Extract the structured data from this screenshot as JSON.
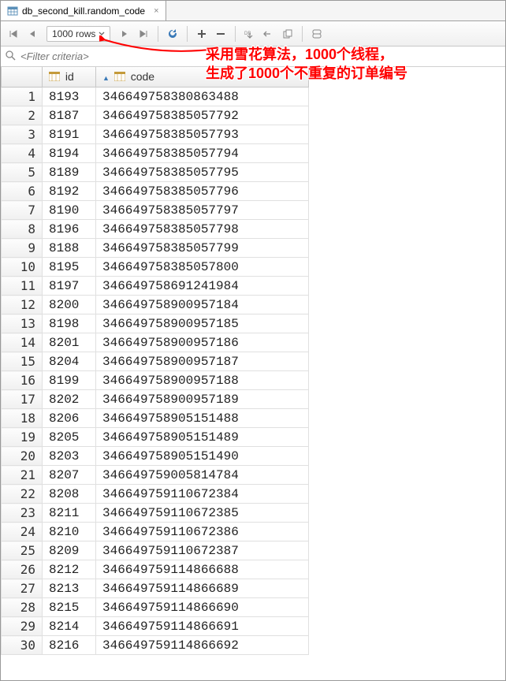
{
  "tab": {
    "label": "db_second_kill.random_code",
    "close": "×"
  },
  "toolbar": {
    "rows_label": "1000 rows"
  },
  "filter": {
    "placeholder": "<Filter criteria>"
  },
  "annotation": {
    "line1": "采用雪花算法，1000个线程，",
    "line2": "生成了1000个不重复的订单编号"
  },
  "columns": {
    "id": "id",
    "code": "code"
  },
  "rows": [
    {
      "n": 1,
      "id": 8193,
      "code": "346649758380863488"
    },
    {
      "n": 2,
      "id": 8187,
      "code": "346649758385057792"
    },
    {
      "n": 3,
      "id": 8191,
      "code": "346649758385057793"
    },
    {
      "n": 4,
      "id": 8194,
      "code": "346649758385057794"
    },
    {
      "n": 5,
      "id": 8189,
      "code": "346649758385057795"
    },
    {
      "n": 6,
      "id": 8192,
      "code": "346649758385057796"
    },
    {
      "n": 7,
      "id": 8190,
      "code": "346649758385057797"
    },
    {
      "n": 8,
      "id": 8196,
      "code": "346649758385057798"
    },
    {
      "n": 9,
      "id": 8188,
      "code": "346649758385057799"
    },
    {
      "n": 10,
      "id": 8195,
      "code": "346649758385057800"
    },
    {
      "n": 11,
      "id": 8197,
      "code": "346649758691241984"
    },
    {
      "n": 12,
      "id": 8200,
      "code": "346649758900957184"
    },
    {
      "n": 13,
      "id": 8198,
      "code": "346649758900957185"
    },
    {
      "n": 14,
      "id": 8201,
      "code": "346649758900957186"
    },
    {
      "n": 15,
      "id": 8204,
      "code": "346649758900957187"
    },
    {
      "n": 16,
      "id": 8199,
      "code": "346649758900957188"
    },
    {
      "n": 17,
      "id": 8202,
      "code": "346649758900957189"
    },
    {
      "n": 18,
      "id": 8206,
      "code": "346649758905151488"
    },
    {
      "n": 19,
      "id": 8205,
      "code": "346649758905151489"
    },
    {
      "n": 20,
      "id": 8203,
      "code": "346649758905151490"
    },
    {
      "n": 21,
      "id": 8207,
      "code": "346649759005814784"
    },
    {
      "n": 22,
      "id": 8208,
      "code": "346649759110672384"
    },
    {
      "n": 23,
      "id": 8211,
      "code": "346649759110672385"
    },
    {
      "n": 24,
      "id": 8210,
      "code": "346649759110672386"
    },
    {
      "n": 25,
      "id": 8209,
      "code": "346649759110672387"
    },
    {
      "n": 26,
      "id": 8212,
      "code": "346649759114866688"
    },
    {
      "n": 27,
      "id": 8213,
      "code": "346649759114866689"
    },
    {
      "n": 28,
      "id": 8215,
      "code": "346649759114866690"
    },
    {
      "n": 29,
      "id": 8214,
      "code": "346649759114866691"
    },
    {
      "n": 30,
      "id": 8216,
      "code": "346649759114866692"
    }
  ]
}
